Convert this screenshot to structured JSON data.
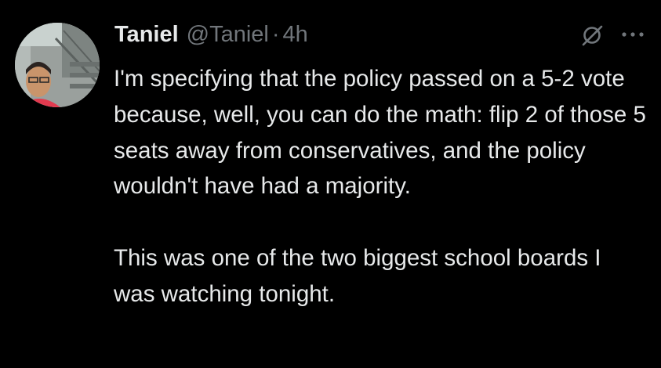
{
  "tweet": {
    "author_name": "Taniel",
    "author_handle": "@Taniel",
    "separator": "·",
    "timestamp": "4h",
    "paragraphs": [
      "I'm specifying that the policy passed on a 5-2 vote because, well, you can do the math: flip 2 of those 5 seats away from conservatives, and the policy wouldn't have had a majority.",
      "This was one of the two biggest school boards I was watching tonight."
    ]
  },
  "icons": {
    "grok": "grok-icon",
    "more": "more-icon",
    "avatar": "avatar-photo"
  },
  "colors": {
    "background": "#000000",
    "text_primary": "#e7e9ea",
    "text_secondary": "#71767b",
    "link": "#1d9bf0"
  }
}
